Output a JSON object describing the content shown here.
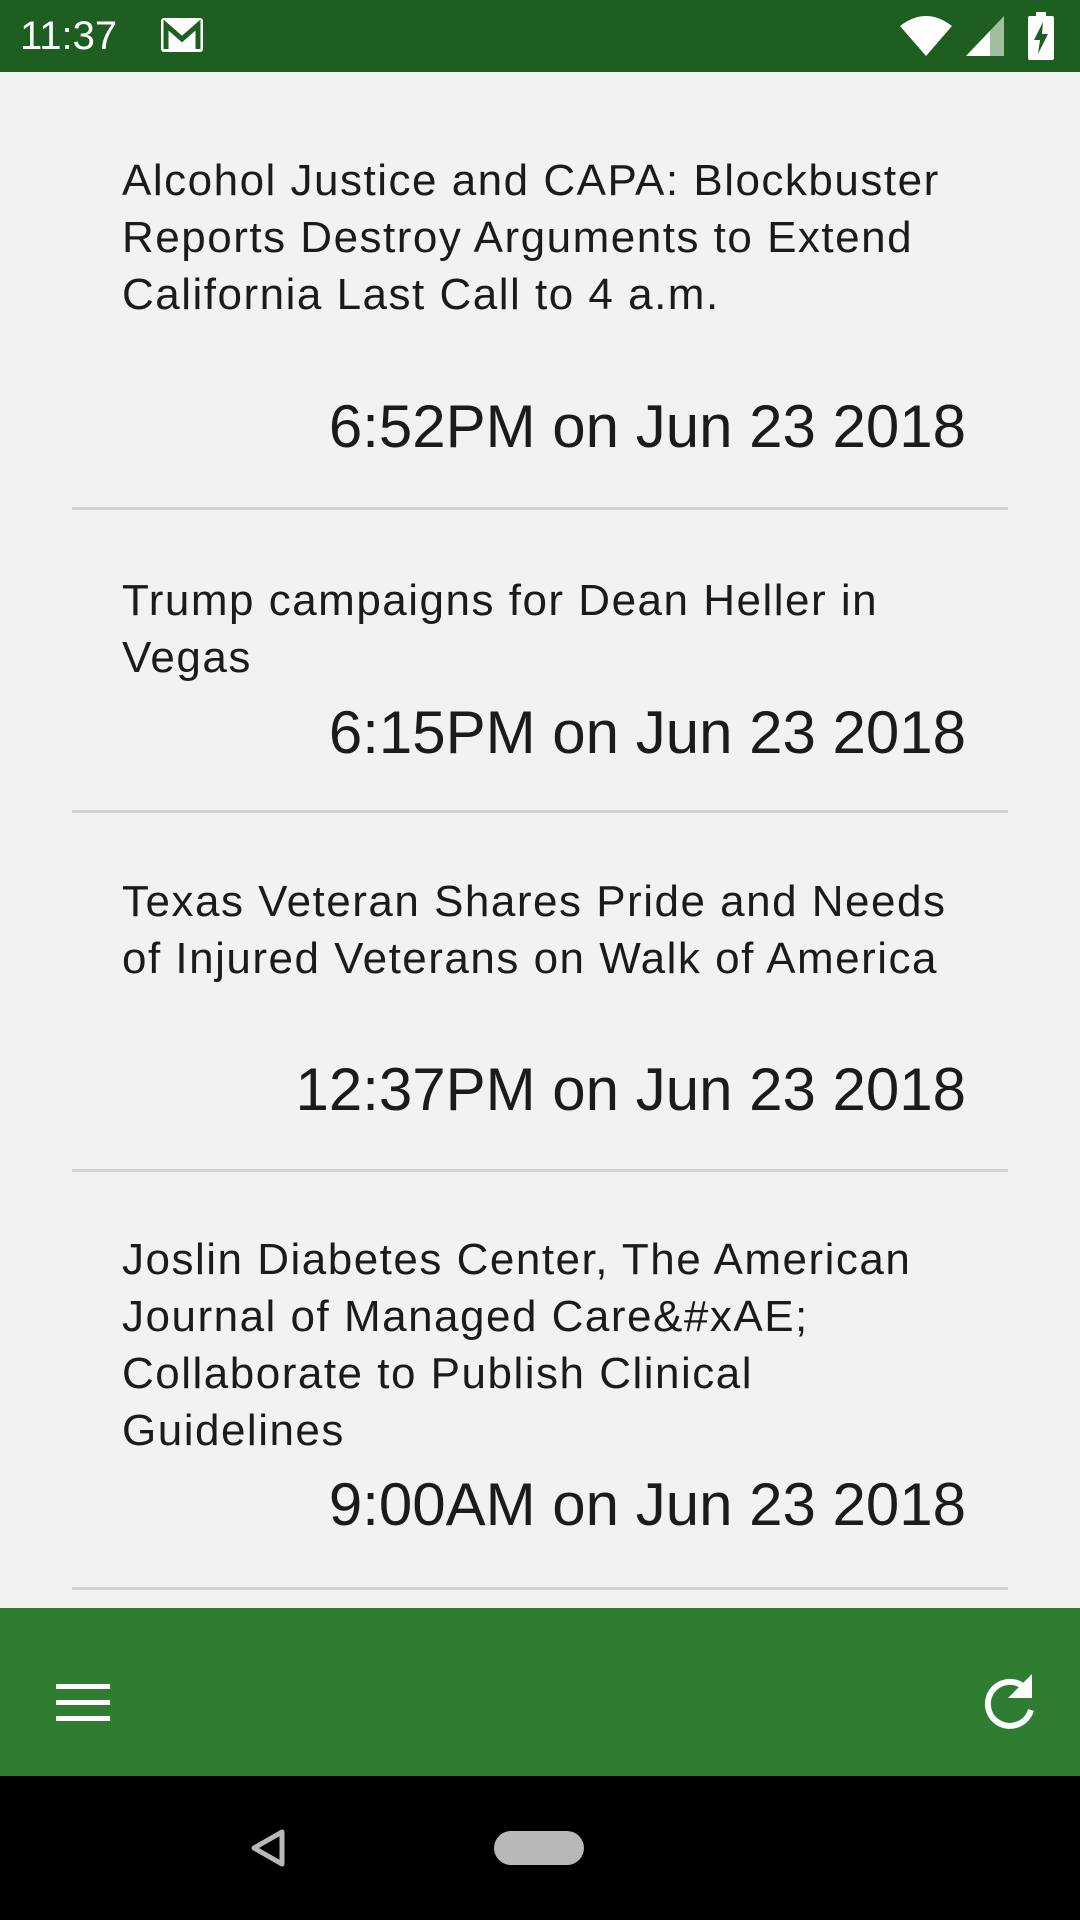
{
  "status_bar": {
    "time": "11:37",
    "icons": [
      "gmail-icon",
      "wifi-icon",
      "cell-signal-icon",
      "battery-charging-icon"
    ]
  },
  "feed": {
    "items": [
      {
        "title": "Alcohol Justice and CAPA: Blockbuster Reports Destroy Arguments to Extend California Last Call to 4 a.m.",
        "date": "6:52PM on Jun 23 2018"
      },
      {
        "title": "Trump campaigns for Dean Heller in Vegas",
        "date": "6:15PM on Jun 23 2018"
      },
      {
        "title": "Texas Veteran Shares Pride and Needs of Injured Veterans on Walk of America",
        "date": "12:37PM on Jun 23 2018"
      },
      {
        "title": "Joslin Diabetes Center, The American Journal of Managed Care&#xAE; Collaborate to Publish Clinical Guidelines",
        "date": "9:00AM on Jun 23 2018"
      }
    ]
  },
  "bottom_bar": {
    "menu_icon": "hamburger-menu-icon",
    "refresh_icon": "refresh-icon"
  },
  "nav_bar": {
    "icons": [
      "back-icon",
      "home-pill-icon"
    ]
  },
  "colors": {
    "status_bar": "#1e5e20",
    "bottom_bar": "#2e7d31",
    "background": "#f2f2f2",
    "divider": "#d4d4d4"
  }
}
